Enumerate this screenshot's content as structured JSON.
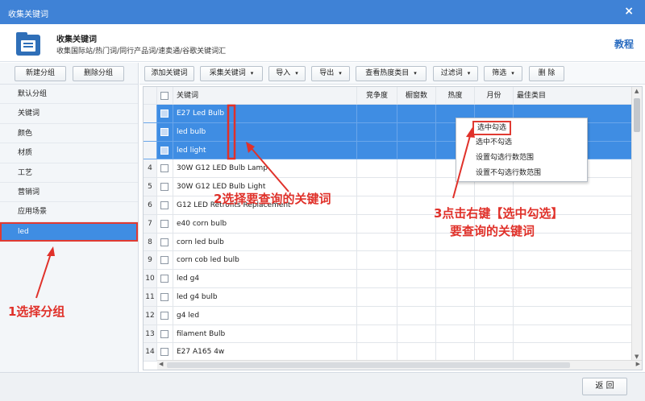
{
  "window": {
    "title": "收集关键词",
    "close": "×"
  },
  "header": {
    "title": "收集关键词",
    "subtitle": "收集国际站/热门词/同行产品词/速卖通/谷歌关键词汇",
    "tutorial": "教程"
  },
  "sidebar": {
    "new_group": "新建分组",
    "delete_group": "删除分组",
    "groups": [
      "默认分组",
      "关键词",
      "颜色",
      "材质",
      "工艺",
      "营销词",
      "应用场景",
      "led"
    ],
    "selected": "led"
  },
  "toolbar": {
    "add": "添加关键词",
    "collect": "采集关键词",
    "import": "导入",
    "export": "导出",
    "heat_category": "查看热度类目",
    "filter_words": "过滤词",
    "screen": "筛选",
    "delete": "删 除",
    "dropdown_arrow": "▾"
  },
  "table": {
    "columns": [
      "关键词",
      "竞争度",
      "橱窗数",
      "热度",
      "月份",
      "最佳类目"
    ],
    "rows": [
      {
        "num": "",
        "keyword": "E27 Led Bulb",
        "selected": true
      },
      {
        "num": "",
        "keyword": "led bulb",
        "selected": true
      },
      {
        "num": "",
        "keyword": "led light",
        "selected": true
      },
      {
        "num": "4",
        "keyword": "30W G12 LED Bulb Lamp",
        "selected": false
      },
      {
        "num": "5",
        "keyword": "30W G12 LED Bulb Light",
        "selected": false
      },
      {
        "num": "6",
        "keyword": "G12 LED Retrofits Replacement",
        "selected": false
      },
      {
        "num": "7",
        "keyword": "e40 corn bulb",
        "selected": false
      },
      {
        "num": "8",
        "keyword": "corn led bulb",
        "selected": false
      },
      {
        "num": "9",
        "keyword": "corn cob led bulb",
        "selected": false
      },
      {
        "num": "10",
        "keyword": "led g4",
        "selected": false
      },
      {
        "num": "11",
        "keyword": "led g4 bulb",
        "selected": false
      },
      {
        "num": "12",
        "keyword": "g4 led",
        "selected": false
      },
      {
        "num": "13",
        "keyword": "filament  Bulb",
        "selected": false
      },
      {
        "num": "14",
        "keyword": "E27 A165 4w",
        "selected": false
      }
    ]
  },
  "context_menu": [
    "选中勾选",
    "选中不勾选",
    "设置勾选行数范围",
    "设置不勾选行数范围"
  ],
  "footer": {
    "back": "返 回"
  },
  "annotations": {
    "step1": "1选择分组",
    "step2": "2选择要查询的关键词",
    "step3_line1": "3点击右键【选中勾选】",
    "step3_line2": "要查询的关键词"
  },
  "colors": {
    "titlebar": "#3f82d6",
    "selection": "#3f8de3",
    "annotation": "#e0312a",
    "tutorial": "#2a6cc0"
  }
}
